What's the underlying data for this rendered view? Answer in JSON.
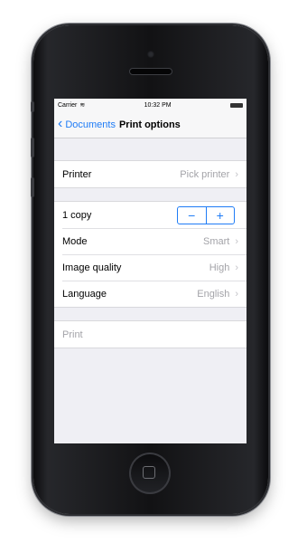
{
  "status_bar": {
    "carrier": "Carrier",
    "time": "10:32 PM"
  },
  "nav": {
    "back_label": "Documents",
    "title": "Print options"
  },
  "printer_row": {
    "label": "Printer",
    "value": "Pick printer"
  },
  "copies_row": {
    "label": "1 copy",
    "decrement": "−",
    "increment": "+"
  },
  "settings_rows": [
    {
      "label": "Mode",
      "value": "Smart"
    },
    {
      "label": "Image quality",
      "value": "High"
    },
    {
      "label": "Language",
      "value": "English"
    }
  ],
  "print_row": {
    "label": "Print"
  },
  "colors": {
    "accent": "#1f7cf6",
    "secondary_text": "#a3a3a8",
    "background": "#efeff4"
  }
}
